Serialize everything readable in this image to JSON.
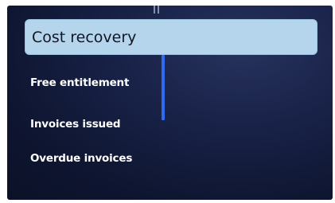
{
  "menu": {
    "selected": {
      "label": "Cost recovery"
    },
    "items": [
      {
        "label": "Free entitlement"
      },
      {
        "label": "Invoices issued"
      },
      {
        "label": "Overdue invoices"
      }
    ]
  },
  "colors": {
    "panel_background": "#182247",
    "selected_background": "#b4d5ec",
    "accent_bar": "#2f6bf0",
    "item_text": "#ffffff"
  }
}
